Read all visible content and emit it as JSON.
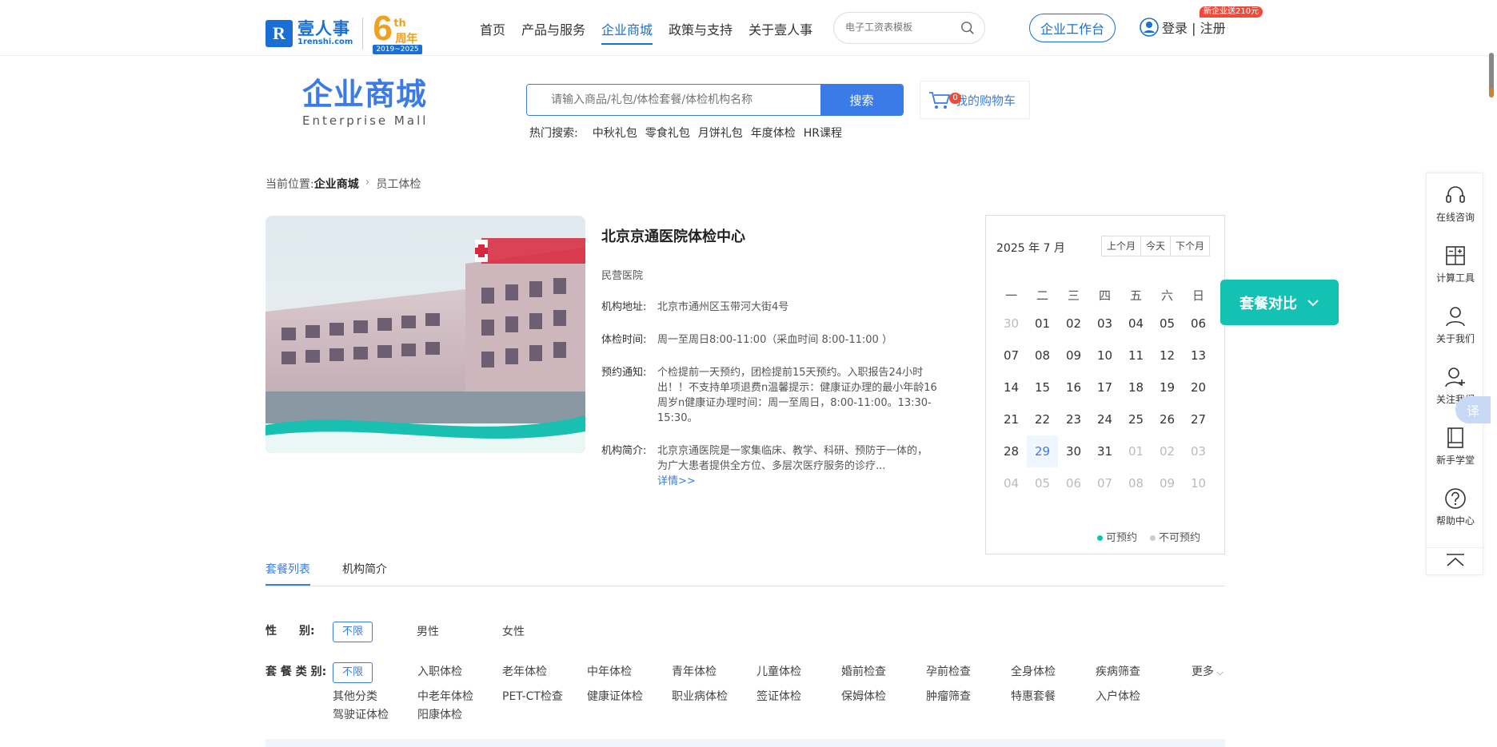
{
  "header": {
    "logo_cn": "壹人事",
    "logo_en": "1renshi.com",
    "anniv_num": "6",
    "anniv_th": "th",
    "anniv_zn": "周年",
    "anniv_years": "2019~2025",
    "nav": [
      "首页",
      "产品与服务",
      "企业商城",
      "政策与支持",
      "关于壹人事"
    ],
    "nav_active_index": 2,
    "search_placeholder": "电子工资表模板",
    "workbench": "企业工作台",
    "login": "登录 | 注册",
    "promo": "新企业送210元"
  },
  "mall": {
    "title_cn": "企业商城",
    "title_en": "Enterprise  Mall",
    "search_placeholder": "请输入商品/礼包/体检套餐/体检机构名称",
    "search_button": "搜索",
    "hot_label": "热门搜索:",
    "hot_items": [
      "中秋礼包",
      "零食礼包",
      "月饼礼包",
      "年度体检",
      "HR课程"
    ],
    "cart_count": "0",
    "cart_label": "我的购物车"
  },
  "breadcrumb": {
    "prefix": "当前位置:",
    "current": "企业商城",
    "page": "员工体检"
  },
  "hospital": {
    "name": "北京京通医院体检中心",
    "type": "民营医院",
    "address_label": "机构地址:",
    "address": "北京市通州区玉带河大街4号",
    "hours_label": "体检时间:",
    "hours": "周一至周日8:00-11:00（采血时间 8:00-11:00 ）",
    "notice_label": "预约通知:",
    "notice": "个检提前一天预约，团检提前15天预约。入职报告24小时出！！不支持单项退费n温馨提示：健康证办理的最小年龄16周岁n健康证办理时间：周一至周日，8:00-11:00。13:30-15:30。",
    "intro_label": "机构简介:",
    "intro": "北京京通医院是一家集临床、教学、科研、预防于一体的，为广大患者提供全方位、多层次医疗服务的诊疗...",
    "detail_link": "详情>>"
  },
  "calendar": {
    "month": "2025 年 7 月",
    "buttons": [
      "上个月",
      "今天",
      "下个月"
    ],
    "weekdays": [
      "一",
      "二",
      "三",
      "四",
      "五",
      "六",
      "日"
    ],
    "days": [
      {
        "d": "30",
        "m": true
      },
      {
        "d": "01"
      },
      {
        "d": "02"
      },
      {
        "d": "03"
      },
      {
        "d": "04"
      },
      {
        "d": "05"
      },
      {
        "d": "06"
      },
      {
        "d": "07"
      },
      {
        "d": "08"
      },
      {
        "d": "09"
      },
      {
        "d": "10"
      },
      {
        "d": "11"
      },
      {
        "d": "12"
      },
      {
        "d": "13"
      },
      {
        "d": "14"
      },
      {
        "d": "15"
      },
      {
        "d": "16"
      },
      {
        "d": "17"
      },
      {
        "d": "18"
      },
      {
        "d": "19"
      },
      {
        "d": "20"
      },
      {
        "d": "21"
      },
      {
        "d": "22"
      },
      {
        "d": "23"
      },
      {
        "d": "24"
      },
      {
        "d": "25"
      },
      {
        "d": "26"
      },
      {
        "d": "27"
      },
      {
        "d": "28"
      },
      {
        "d": "29",
        "t": true
      },
      {
        "d": "30"
      },
      {
        "d": "31"
      },
      {
        "d": "01",
        "m": true
      },
      {
        "d": "02",
        "m": true
      },
      {
        "d": "03",
        "m": true
      },
      {
        "d": "04",
        "m": true
      },
      {
        "d": "05",
        "m": true
      },
      {
        "d": "06",
        "m": true
      },
      {
        "d": "07",
        "m": true
      },
      {
        "d": "08",
        "m": true
      },
      {
        "d": "09",
        "m": true
      },
      {
        "d": "10",
        "m": true
      }
    ],
    "legend_available": "可预约",
    "legend_unavailable": "不可预约",
    "available_color": "#14c2b3",
    "unavailable_color": "#cccccc"
  },
  "compare_button": "套餐对比",
  "tabs": [
    "套餐列表",
    "机构简介"
  ],
  "filters": {
    "gender_label": "性　　别:",
    "gender_options": [
      "不限",
      "男性",
      "女性"
    ],
    "package_label": "套 餐 类 别:",
    "package_options": [
      "不限",
      "入职体检",
      "老年体检",
      "中年体检",
      "青年体检",
      "儿童体检",
      "婚前检查",
      "孕前检查",
      "全身体检",
      "疾病筛查",
      "其他分类",
      "中老年体检",
      "PET-CT检查",
      "健康证体检",
      "职业病体检",
      "签证体检",
      "保姆体检",
      "肿瘤筛查",
      "特惠套餐",
      "入户体检",
      "驾驶证体检",
      "阳康体检"
    ],
    "more": "更多"
  },
  "sidebar": [
    {
      "label": "在线咨询",
      "icon": "headset-icon"
    },
    {
      "label": "计算工具",
      "icon": "calculator-icon"
    },
    {
      "label": "关于我们",
      "icon": "person-icon"
    },
    {
      "label": "关注我们",
      "icon": "add-person-icon"
    },
    {
      "label": "新手学堂",
      "icon": "book-icon"
    },
    {
      "label": "帮助中心",
      "icon": "question-icon"
    },
    {
      "label": "",
      "icon": "back-to-top-icon"
    }
  ],
  "translate": "译",
  "colors": {
    "brand": "#1a6fd4",
    "accent": "#3a7be8",
    "teal": "#14c2b3",
    "badge": "#f04a3a"
  }
}
